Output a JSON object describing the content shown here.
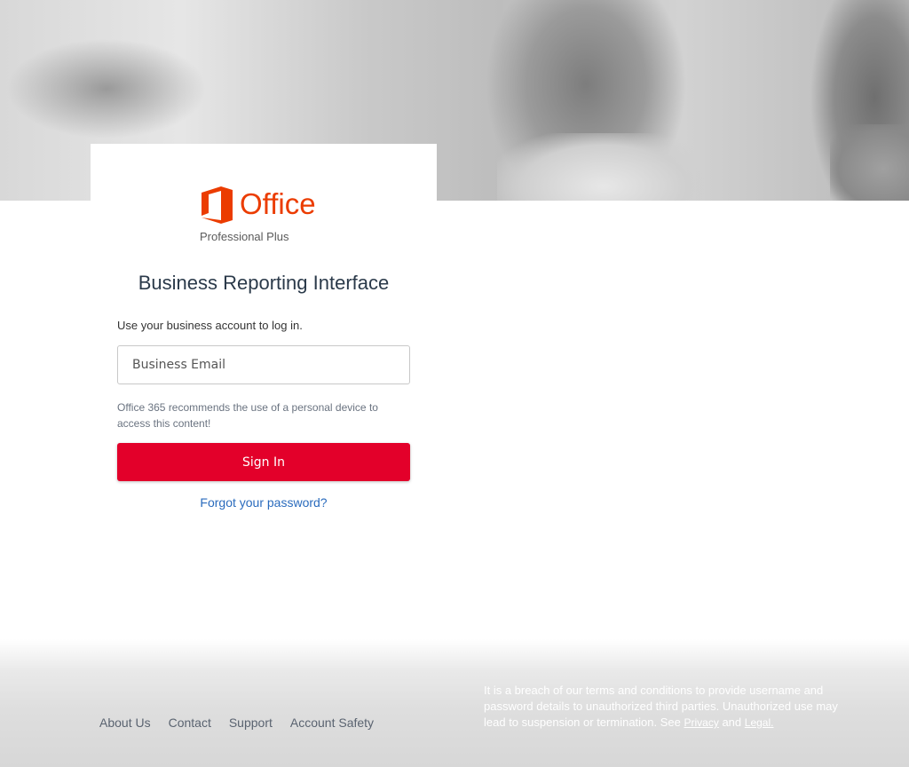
{
  "brand": {
    "product_name": "Office",
    "edition": "Professional Plus",
    "accent_color": "#eb3c00"
  },
  "login": {
    "title": "Business Reporting Interface",
    "instruction": "Use your business account to log in.",
    "email_placeholder": "Business Email",
    "email_value": "",
    "note": "Office 365 recommends the use of a personal device to access this content!",
    "sign_in_label": "Sign In",
    "sign_in_color": "#e3002a",
    "forgot_label": "Forgot your password?"
  },
  "footer": {
    "links": [
      "About Us",
      "Contact",
      "Support",
      "Account Safety"
    ],
    "disclaimer_text": "It is a breach of our terms and conditions to provide username and password details to unauthorized third parties. Unauthorized use may lead to suspension or termination. See",
    "privacy_label": "Privacy",
    "and_text": "and",
    "legal_label": "Legal."
  }
}
